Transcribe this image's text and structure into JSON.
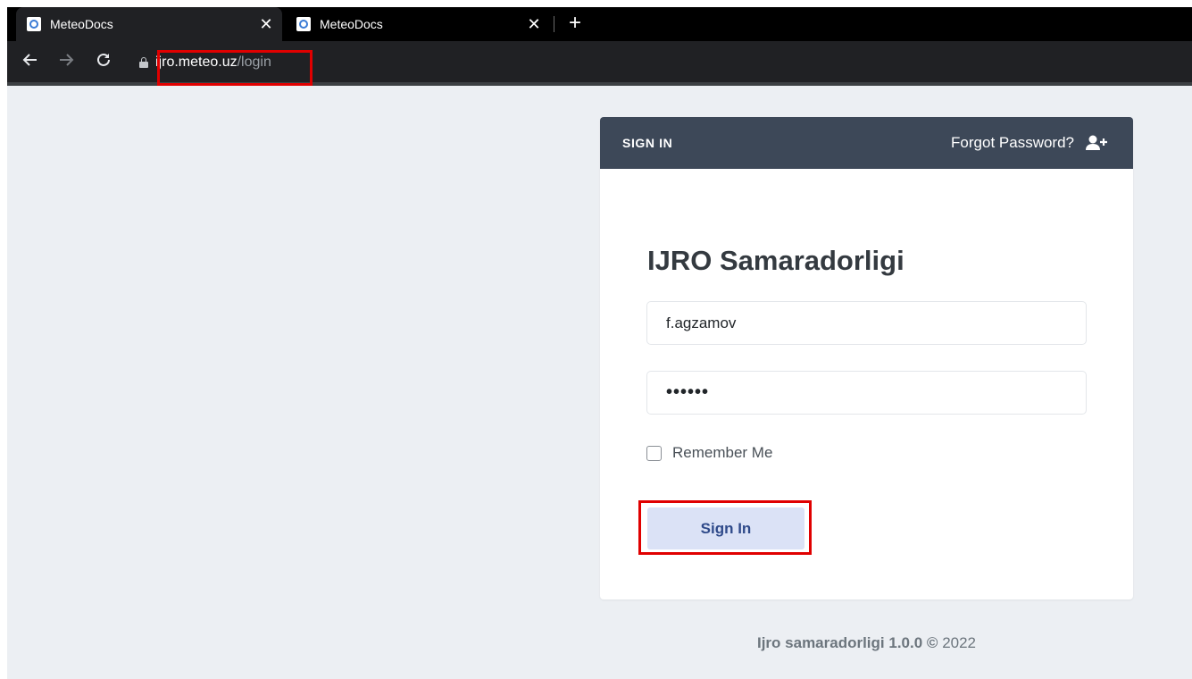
{
  "browser": {
    "tabs": [
      {
        "title": "MeteoDocs",
        "active": true
      },
      {
        "title": "MeteoDocs",
        "active": false
      }
    ],
    "close_glyph": "✕",
    "new_tab_glyph": "+",
    "url_host": "ijro.meteo.uz",
    "url_path": "/login",
    "icons": {
      "back": "arrow-left-icon",
      "forward": "arrow-right-icon",
      "reload": "reload-icon",
      "lock": "lock-icon",
      "favicon": "meteodocs-favicon"
    }
  },
  "login": {
    "header_title": "SIGN IN",
    "forgot_label": "Forgot Password?",
    "forgot_icon": "user-plus-icon",
    "app_title": "IJRO Samaradorligi",
    "username_value": "f.agzamov",
    "password_value": "••••••",
    "remember_label": "Remember Me",
    "remember_checked": false,
    "signin_label": "Sign In"
  },
  "footer": {
    "product": "Ijro samaradorligi 1.0.0",
    "copyright_symbol": "©",
    "year": "2022"
  },
  "colors": {
    "page_bg": "#eceff3",
    "card_header_bg": "#3d4858",
    "button_bg": "#dbe2f6",
    "button_text": "#2f4a8a",
    "highlight_red": "#e00000"
  }
}
